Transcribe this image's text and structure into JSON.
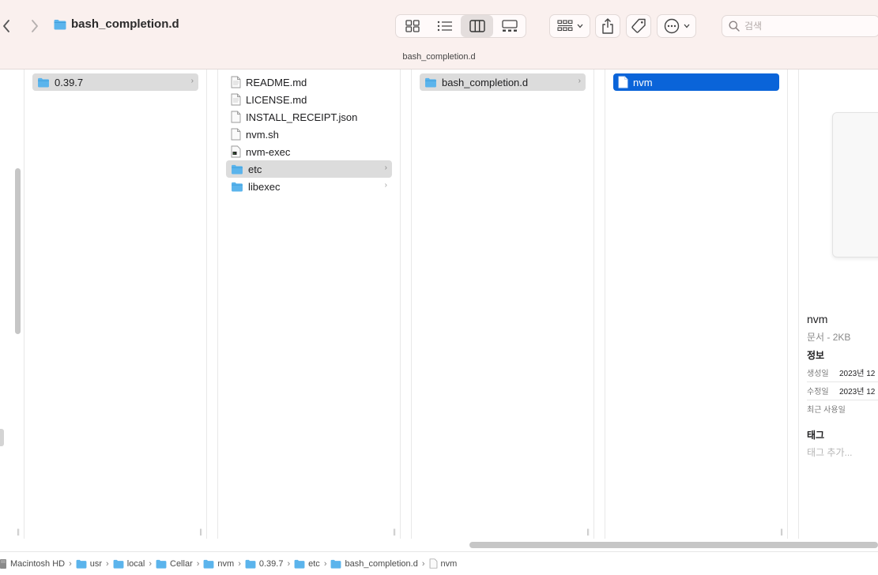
{
  "window": {
    "title": "bash_completion.d",
    "path_title": "bash_completion.d"
  },
  "toolbar": {
    "back_icon": "chevron-left-icon",
    "forward_icon": "chevron-right-icon",
    "view_modes": [
      "icon-view",
      "list-view",
      "column-view",
      "gallery-view"
    ],
    "active_view": "column-view",
    "search": {
      "placeholder": "검색",
      "value": ""
    }
  },
  "columns": [
    {
      "items": [
        {
          "name": "0.39.7",
          "kind": "folder",
          "selected": "gray",
          "has_children": true
        }
      ]
    },
    {
      "items": [
        {
          "name": "README.md",
          "kind": "doc"
        },
        {
          "name": "LICENSE.md",
          "kind": "doc"
        },
        {
          "name": "INSTALL_RECEIPT.json",
          "kind": "doc"
        },
        {
          "name": "nvm.sh",
          "kind": "doc"
        },
        {
          "name": "nvm-exec",
          "kind": "exec"
        },
        {
          "name": "etc",
          "kind": "folder",
          "selected": "gray",
          "has_children": true
        },
        {
          "name": "libexec",
          "kind": "folder",
          "has_children": true
        }
      ]
    },
    {
      "items": [
        {
          "name": "bash_completion.d",
          "kind": "folder",
          "selected": "gray",
          "has_children": true
        }
      ]
    },
    {
      "items": [
        {
          "name": "nvm",
          "kind": "doc",
          "selected": "blue"
        }
      ]
    }
  ],
  "preview": {
    "name": "nvm",
    "kind_size": "문서 - 2KB",
    "info_heading": "정보",
    "created_label": "생성일",
    "created_value": "2023년 12",
    "modified_label": "수정일",
    "modified_value": "2023년 12",
    "last_opened_label": "최근 사용일",
    "tags_heading": "태그",
    "add_tags": "태그 추가..."
  },
  "breadcrumb": [
    "Macintosh HD",
    "usr",
    "local",
    "Cellar",
    "nvm",
    "0.39.7",
    "etc",
    "bash_completion.d",
    "nvm"
  ],
  "colors": {
    "selection_blue": "#0a64d9",
    "folder_blue": "#5bb4ec",
    "toolbar_bg": "#faf0ee"
  }
}
